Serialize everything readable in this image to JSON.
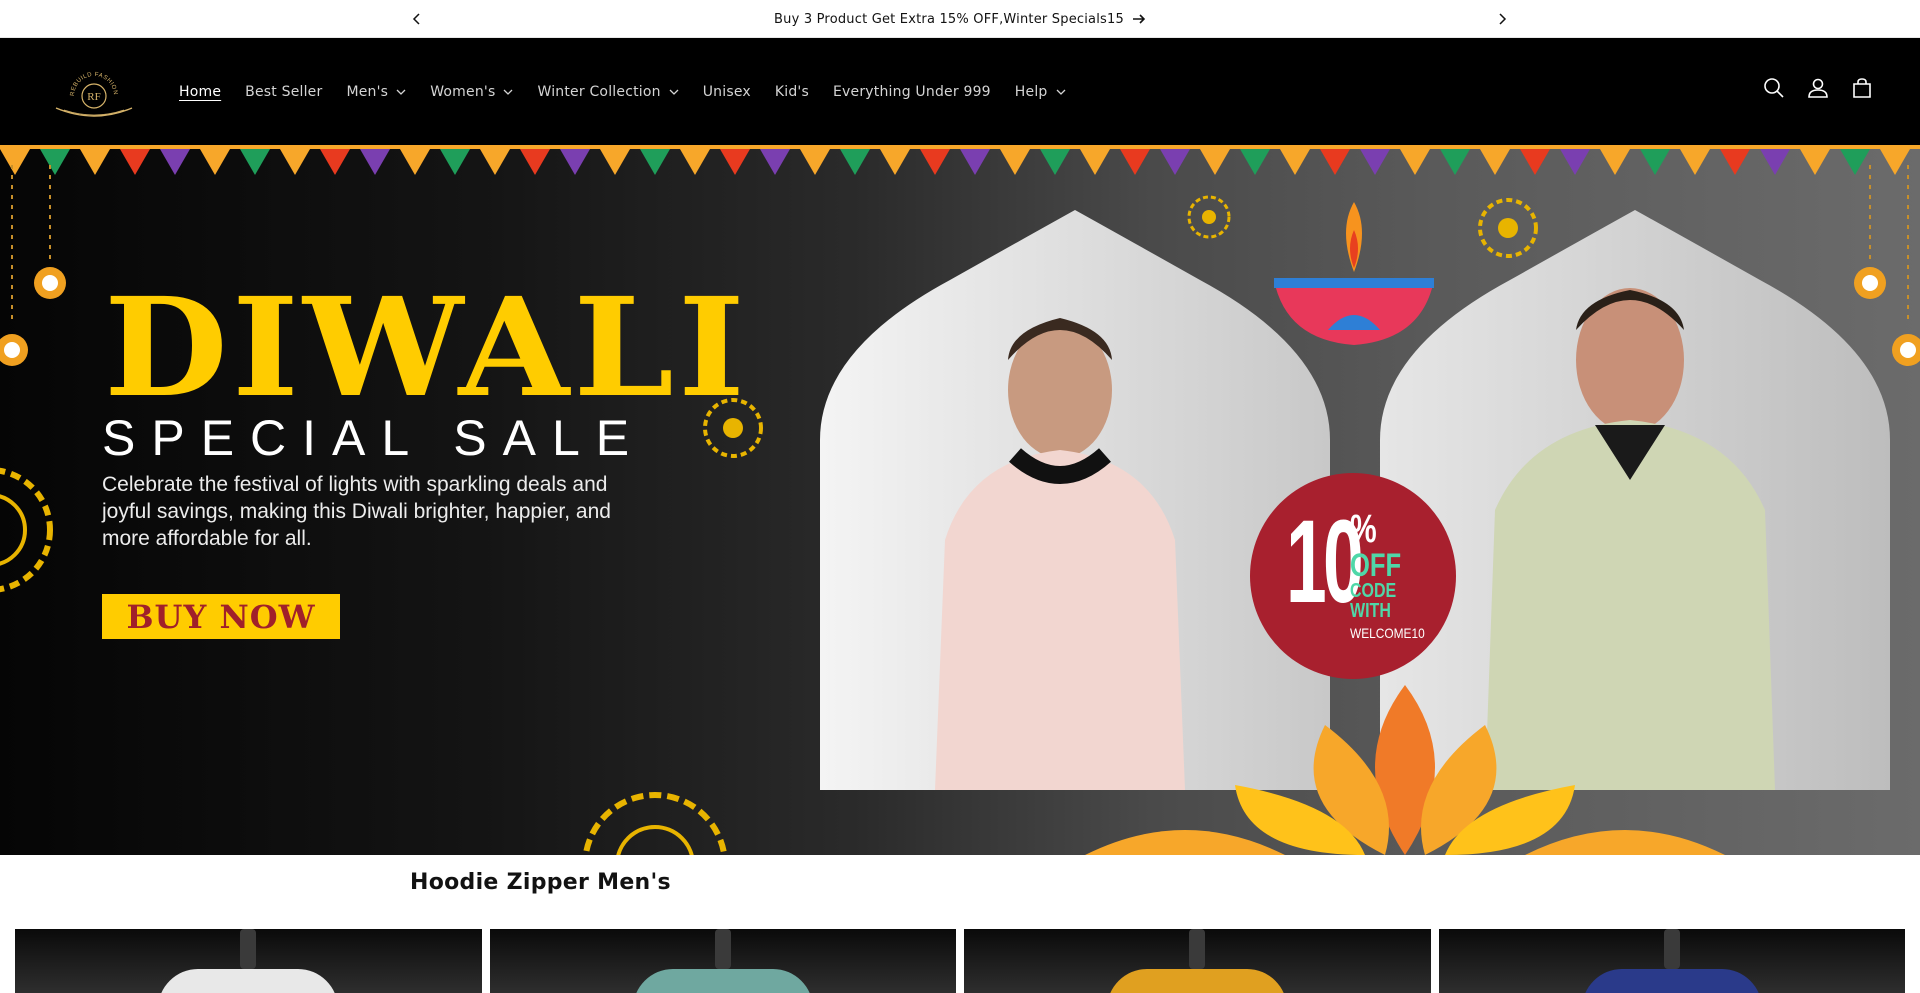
{
  "announcement": {
    "message": "Buy 3 Product Get Extra 15% OFF,Winter Specials15",
    "prev_icon": "chevron-left-icon",
    "next_icon": "chevron-right-icon",
    "link_icon": "arrow-right-icon"
  },
  "header": {
    "logo_text": "RF",
    "logo_arc_text": "REBUILD FASHION",
    "nav": [
      {
        "label": "Home",
        "active": true,
        "dropdown": false
      },
      {
        "label": "Best Seller",
        "active": false,
        "dropdown": false
      },
      {
        "label": "Men's",
        "active": false,
        "dropdown": true
      },
      {
        "label": "Women's",
        "active": false,
        "dropdown": true
      },
      {
        "label": "Winter Collection",
        "active": false,
        "dropdown": true
      },
      {
        "label": "Unisex",
        "active": false,
        "dropdown": false
      },
      {
        "label": "Kid's",
        "active": false,
        "dropdown": false
      },
      {
        "label": "Everything Under 999",
        "active": false,
        "dropdown": false
      },
      {
        "label": "Help",
        "active": false,
        "dropdown": true
      }
    ],
    "icons": [
      "search-icon",
      "account-icon",
      "cart-icon"
    ]
  },
  "hero": {
    "title": "DIWALI",
    "subtitle": "SPECIAL SALE",
    "description": "Celebrate the festival of lights with sparkling deals and joyful savings, making this Diwali brighter, happier, and more affordable for all.",
    "cta": "BUY NOW",
    "badge": {
      "number": "10",
      "percent": "%",
      "off": "OFF",
      "code_line1": "CODE",
      "code_line2": "WITH",
      "promo_code": "WELCOME10"
    },
    "colors": {
      "title": "#ffcc00",
      "cta_bg": "#ffcc00",
      "cta_text": "#a0202a",
      "badge_bg": "#a8202e",
      "badge_accent": "#4fd7a8"
    }
  },
  "section": {
    "title": "Hoodie Zipper Men's",
    "cards": [
      {
        "accent": "#e8e8e8"
      },
      {
        "accent": "#6fa8a0"
      },
      {
        "accent": "#e0a020"
      },
      {
        "accent": "#2a3a8a"
      }
    ]
  }
}
